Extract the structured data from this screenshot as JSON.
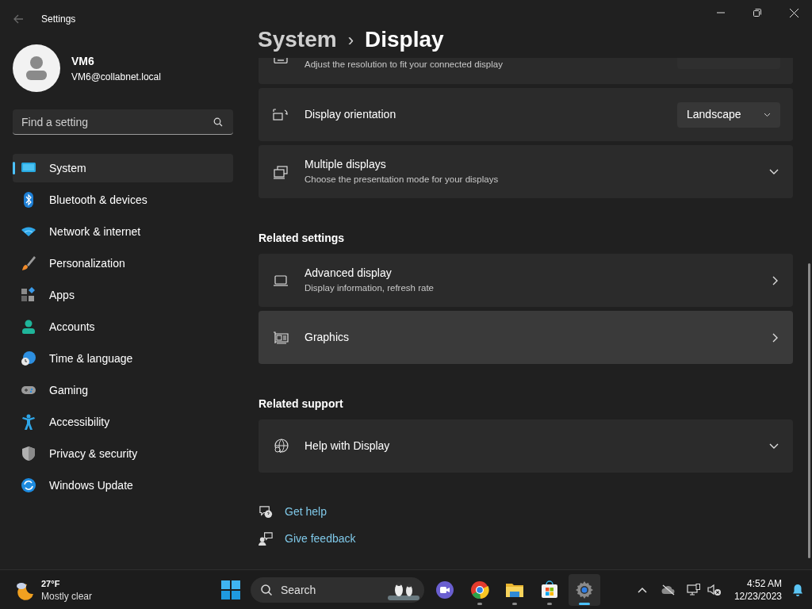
{
  "window": {
    "title": "Settings"
  },
  "user": {
    "name": "VM6",
    "email": "VM6@collabnet.local"
  },
  "search": {
    "placeholder": "Find a setting"
  },
  "sidebar": {
    "items": [
      {
        "label": "System",
        "selected": true
      },
      {
        "label": "Bluetooth & devices",
        "selected": false
      },
      {
        "label": "Network & internet",
        "selected": false
      },
      {
        "label": "Personalization",
        "selected": false
      },
      {
        "label": "Apps",
        "selected": false
      },
      {
        "label": "Accounts",
        "selected": false
      },
      {
        "label": "Time & language",
        "selected": false
      },
      {
        "label": "Gaming",
        "selected": false
      },
      {
        "label": "Accessibility",
        "selected": false
      },
      {
        "label": "Privacy & security",
        "selected": false
      },
      {
        "label": "Windows Update",
        "selected": false
      }
    ]
  },
  "breadcrumb": {
    "parent": "System",
    "separator": "›",
    "current": "Display"
  },
  "cards": [
    {
      "kind": "partial",
      "description": "Adjust the resolution to fit your connected display"
    },
    {
      "kind": "select",
      "title": "Display orientation",
      "value": "Landscape"
    },
    {
      "kind": "expander",
      "title": "Multiple displays",
      "description": "Choose the presentation mode for your displays"
    },
    {
      "kind": "heading",
      "title": "Related settings"
    },
    {
      "kind": "link",
      "title": "Advanced display",
      "description": "Display information, refresh rate",
      "hovered": false
    },
    {
      "kind": "link",
      "title": "Graphics",
      "hovered": true
    },
    {
      "kind": "heading",
      "title": "Related support"
    },
    {
      "kind": "expander",
      "title": "Help with Display"
    }
  ],
  "help_links": [
    "Get help",
    "Give feedback"
  ],
  "taskbar": {
    "weather": {
      "temperature": "27°F",
      "condition": "Mostly clear"
    },
    "search": {
      "placeholder": "Search"
    },
    "apps": [
      {
        "running": false,
        "selected": false
      },
      {
        "running": true,
        "selected": false
      },
      {
        "running": true,
        "selected": false
      },
      {
        "running": true,
        "selected": false
      },
      {
        "running": true,
        "selected": true
      }
    ],
    "clock": {
      "time": "4:52 AM",
      "date": "12/23/2023"
    }
  }
}
